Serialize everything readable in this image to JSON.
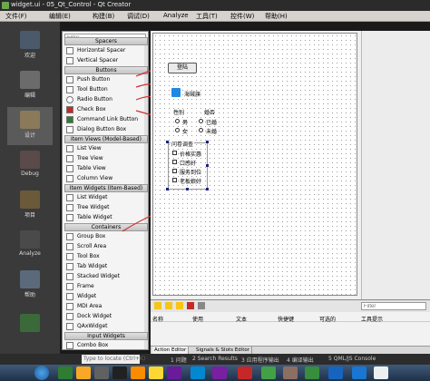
{
  "window": {
    "title": "widget.ui - 05_Qt_Control - Qt Creator"
  },
  "menu": [
    "文件(F)",
    "编辑(E)",
    "构建(B)",
    "调试(D)",
    "Analyze",
    "工具(T)",
    "控件(W)",
    "帮助(H)"
  ],
  "modes": [
    {
      "label": "欢迎",
      "icon": "welcome-icon"
    },
    {
      "label": "编辑",
      "icon": "edit-icon"
    },
    {
      "label": "设计",
      "icon": "design-icon"
    },
    {
      "label": "Debug",
      "icon": "debug-icon"
    },
    {
      "label": "项目",
      "icon": "projects-icon"
    },
    {
      "label": "Analyze",
      "icon": "analyze-icon"
    },
    {
      "label": "帮助",
      "icon": "help-icon"
    }
  ],
  "widgetbox": {
    "filter_placeholder": "Filter",
    "sections": [
      {
        "title": "Spacers",
        "items": [
          "Horizontal Spacer",
          "Vertical Spacer"
        ]
      },
      {
        "title": "Buttons",
        "items": [
          "Push Button",
          "Tool Button",
          "Radio Button",
          "Check Box",
          "Command Link Button",
          "Dialog Button Box"
        ]
      },
      {
        "title": "Item Views (Model-Based)",
        "items": [
          "List View",
          "Tree View",
          "Table View",
          "Column View"
        ]
      },
      {
        "title": "Item Widgets (Item-Based)",
        "items": [
          "List Widget",
          "Tree Widget",
          "Table Widget"
        ]
      },
      {
        "title": "Containers",
        "items": [
          "Group Box",
          "Scroll Area",
          "Tool Box",
          "Tab Widget",
          "Stacked Widget",
          "Frame",
          "Widget",
          "MDI Area",
          "Dock Widget",
          "QAxWidget"
        ]
      },
      {
        "title": "Input Widgets",
        "items": [
          "Combo Box"
        ]
      }
    ]
  },
  "form": {
    "login_button": "登陆",
    "tool_label": "海贼旗",
    "gender_label": "性别",
    "marriage_label": "婚否",
    "male": "男",
    "female": "女",
    "married": "已婚",
    "unmarried": "未婚",
    "survey_title": "问卷调查",
    "survey_options": [
      "价格实惠",
      "口感好",
      "服务到位",
      "老板娘好"
    ]
  },
  "action_editor": {
    "filter_placeholder": "Filter",
    "columns": [
      "名称",
      "使用",
      "文本",
      "快捷键",
      "可选的",
      "工具提示"
    ],
    "tabs": [
      "Action Editor",
      "Signals & Slots Editor"
    ]
  },
  "status_bar": {
    "search_placeholder": "Type to locate (Ctrl+K)",
    "items": [
      "1 问题",
      "2 Search Results",
      "3 应用程序输出",
      "4 编译输出",
      "5 QML/JS Console"
    ]
  }
}
